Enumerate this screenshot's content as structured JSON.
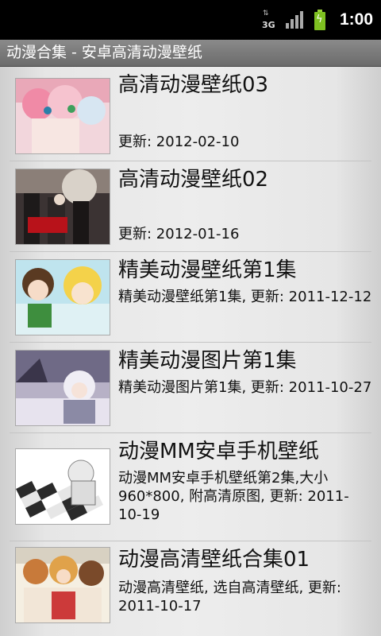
{
  "status_bar": {
    "network_label": "3G",
    "time": "1:00"
  },
  "title_bar": {
    "title": "动漫合集 - 安卓高清动漫壁纸"
  },
  "items": [
    {
      "title": "高清动漫壁纸03",
      "desc": "更新: 2012-02-10"
    },
    {
      "title": "高清动漫壁纸02",
      "desc": "更新: 2012-01-16"
    },
    {
      "title": "精美动漫壁纸第1集",
      "desc": "精美动漫壁纸第1集, 更新: 2011-12-12"
    },
    {
      "title": "精美动漫图片第1集",
      "desc": "精美动漫图片第1集, 更新: 2011-10-27"
    },
    {
      "title": "动漫MM安卓手机壁纸",
      "desc": "动漫MM安卓手机壁纸第2集,大小960*800, 附高清原图, 更新: 2011-10-19"
    },
    {
      "title": "动漫高清壁纸合集01",
      "desc": "动漫高清壁纸, 选自高清壁纸, 更新: 2011-10-17"
    }
  ],
  "colors": {
    "status_bg": "#000000",
    "title_bar_bg": "#7a7a7a",
    "list_bg": "#ececec",
    "battery": "#7ec021"
  }
}
